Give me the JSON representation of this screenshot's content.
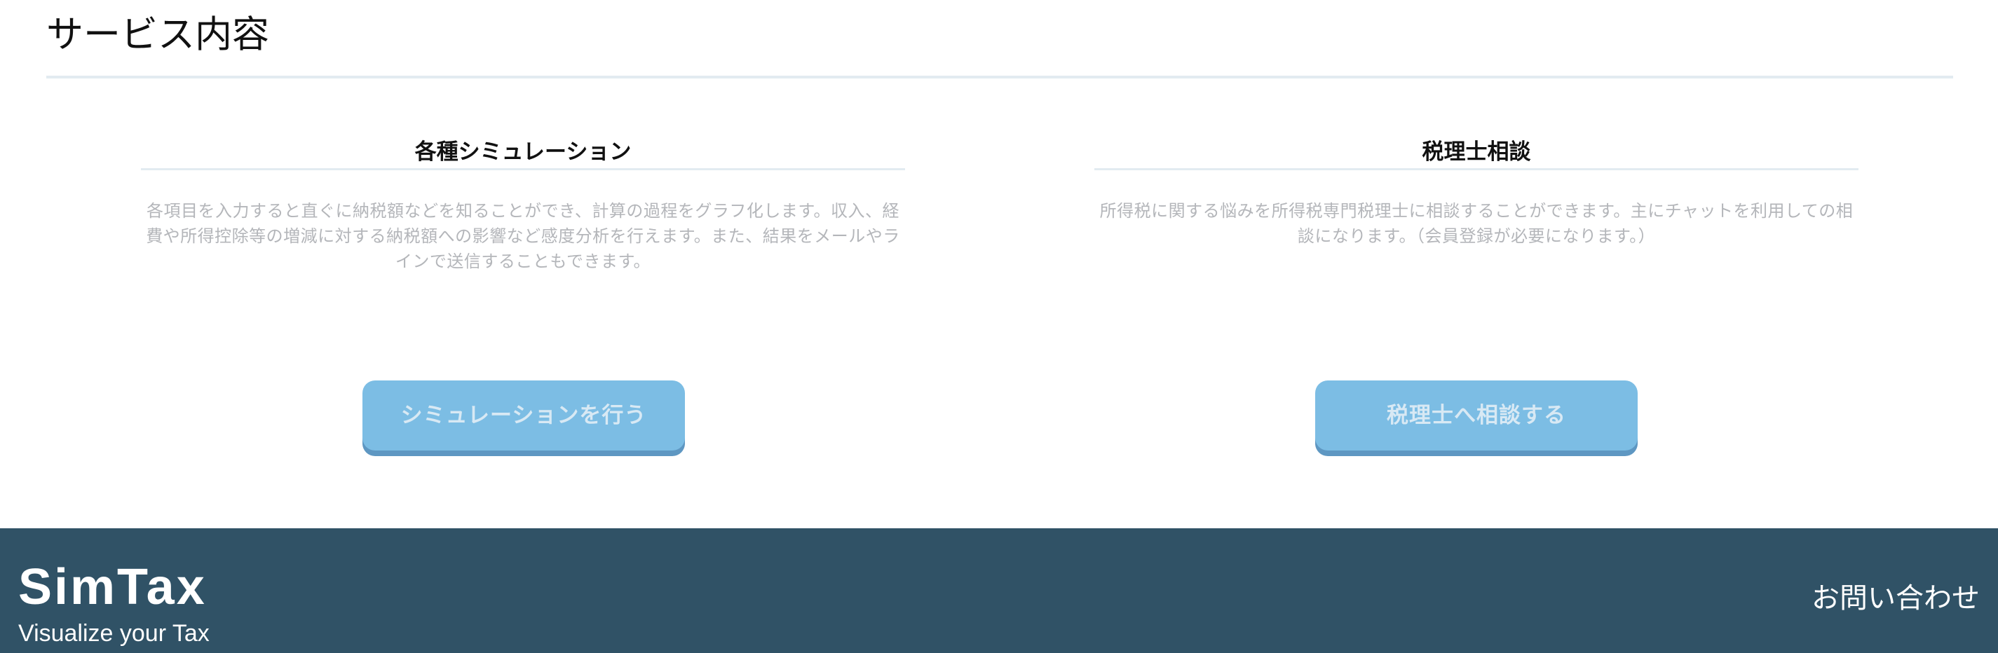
{
  "services": {
    "title": "サービス内容",
    "cards": [
      {
        "title": "各種シミュレーション",
        "description": "各項目を入力すると直ぐに納税額などを知ることができ、計算の過程をグラフ化します。収入、経費や所得控除等の増減に対する納税額への影響など感度分析を行えます。また、結果をメールやラインで送信することもできます。",
        "button_label": "シミュレーションを行う"
      },
      {
        "title": "税理士相談",
        "description": "所得税に関する悩みを所得税専門税理士に相談することができます。主にチャットを利用しての相談になります。（会員登録が必要になります。）",
        "button_label": "税理士へ相談する"
      }
    ]
  },
  "footer": {
    "brand": "SimTax",
    "tagline": "Visualize your Tax",
    "contact_link": "お問い合わせ"
  },
  "colors": {
    "button": "#7cbde4",
    "button_shadow": "#5e97c2",
    "footer_bg": "#305266",
    "description_text": "#b4b6ba",
    "divider": "#e2ebf1"
  }
}
